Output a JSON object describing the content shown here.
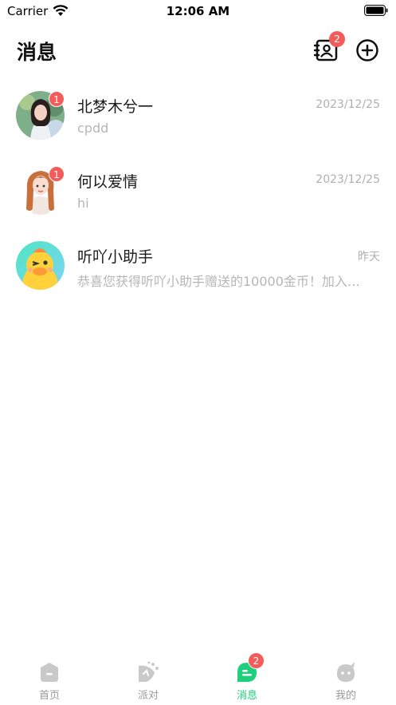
{
  "status_bar": {
    "carrier": "Carrier",
    "time": "12:06 AM"
  },
  "header": {
    "title": "消息",
    "contacts_badge": "2"
  },
  "conversations": [
    {
      "name": "北梦木兮一",
      "message": "cpdd",
      "time": "2023/12/25",
      "unread": "1",
      "avatar_icon": "girl-photo-avatar"
    },
    {
      "name": "何以爱情",
      "message": "hi",
      "time": "2023/12/25",
      "unread": "1",
      "avatar_icon": "cartoon-girl-avatar"
    },
    {
      "name": "听吖小助手",
      "message": "恭喜您获得听吖小助手赠送的10000金币！加入…",
      "time": "昨天",
      "unread": "",
      "avatar_icon": "duck-assistant-avatar"
    }
  ],
  "tab_bar": {
    "tabs": [
      {
        "label": "首页",
        "icon": "home-icon"
      },
      {
        "label": "派对",
        "icon": "party-icon"
      },
      {
        "label": "消息",
        "icon": "message-icon",
        "badge": "2"
      },
      {
        "label": "我的",
        "icon": "profile-icon"
      }
    ],
    "active_tab": "消息"
  },
  "colors": {
    "accent": "#1fcf7c",
    "badge": "#f45b5b",
    "muted_text": "#b0b0b0"
  }
}
